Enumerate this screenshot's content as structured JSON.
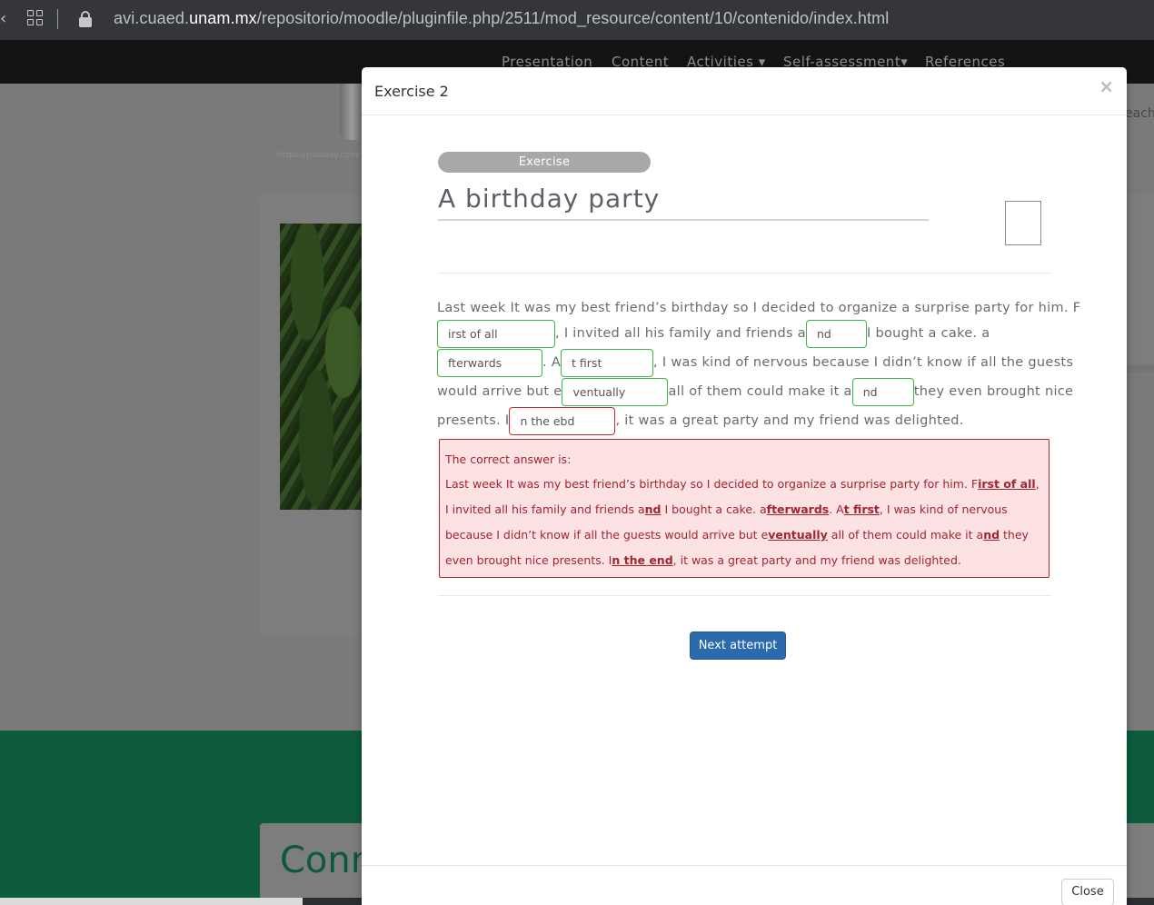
{
  "browser": {
    "url_prefix": "avi.cuaed.",
    "url_domain": "unam.mx",
    "url_path": "/repositorio/moodle/pluginfile.php/2511/mod_resource/content/10/contenido/index.html"
  },
  "nav": {
    "items": [
      "Presentation",
      "Content",
      "Activities ▾",
      "Self-assessment▾",
      "References"
    ]
  },
  "background": {
    "credit": "https://pixabay.com/",
    "side_text": "each",
    "section_heading": "Conn"
  },
  "modal": {
    "title": "Exercise 2",
    "close_x": "×",
    "pill": "Exercise",
    "exercise_title": "A birthday party",
    "passage": {
      "l1": "Last week It was my best friend’s birthday so I decided to organize a surprise party for him. F",
      "b1": "irst of all",
      "l2a": ", I invited all his family and friends a",
      "b2": "nd",
      "l2b": " I bought a cake. a",
      "b3": "fterwards",
      "l3a": ". A",
      "b4": "t first",
      "l3b": ", I was kind of nervous because I didn’t know if all the guests",
      "l4a": "would arrive but e",
      "b5": "ventually",
      "l4b": " all of them could make it a",
      "b6": "nd",
      "l4c": " they even brought nice",
      "l5a": "presents. I",
      "b7": "n the ebd",
      "l5b": ", it was a great party and my friend was delighted."
    },
    "feedback": {
      "label": "The correct answer is:",
      "t1": "Last week It was my best friend’s birthday so I decided to organize a surprise party for him. F",
      "a1": "irst of all",
      "t2": ", I invited all his family and friends a",
      "a2": "nd",
      "t3": " I bought a cake. a",
      "a3": "fterwards",
      "t4": ". A",
      "a4": "t first",
      "t5": ", I was kind of nervous because I didn’t know if all the guests would arrive but e",
      "a5": "ventually",
      "t6": " all of them could make it a",
      "a6": "nd",
      "t7": " they even brought nice presents. I",
      "a7": "n the end",
      "t8": ", it was a great party and my friend was delighted."
    },
    "next_button": "Next attempt",
    "close_button": "Close"
  },
  "colors": {
    "correct_border": "#3bb54a",
    "wrong_border": "#c6283a",
    "primary_button": "#2a6aad",
    "feedback_bg": "#fde2e4"
  }
}
